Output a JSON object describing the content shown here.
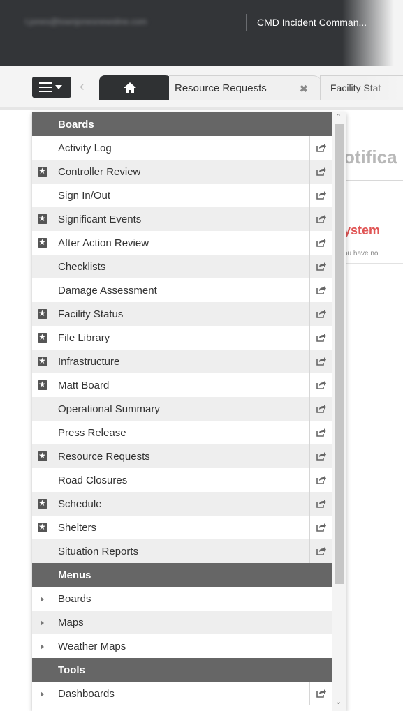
{
  "header": {
    "user_email": "t.jones@townjonesnewsline.com",
    "app_title": "CMD Incident Comman..."
  },
  "tabs": {
    "home_icon": "home-icon",
    "resource_requests": "Resource Requests",
    "facility_status": "Facility Stat"
  },
  "background": {
    "title": "otifica",
    "system": "ystem",
    "note": "ou have no"
  },
  "menu": {
    "boards_header": "Boards",
    "boards": [
      {
        "label": "Activity Log",
        "favorite": false
      },
      {
        "label": "Controller Review",
        "favorite": true
      },
      {
        "label": "Sign In/Out",
        "favorite": false
      },
      {
        "label": "Significant Events",
        "favorite": true
      },
      {
        "label": "After Action Review",
        "favorite": true
      },
      {
        "label": "Checklists",
        "favorite": false
      },
      {
        "label": "Damage Assessment",
        "favorite": false
      },
      {
        "label": "Facility Status",
        "favorite": true
      },
      {
        "label": "File Library",
        "favorite": true
      },
      {
        "label": "Infrastructure",
        "favorite": true
      },
      {
        "label": "Matt Board",
        "favorite": true
      },
      {
        "label": "Operational Summary",
        "favorite": false
      },
      {
        "label": "Press Release",
        "favorite": false
      },
      {
        "label": "Resource Requests",
        "favorite": true
      },
      {
        "label": "Road Closures",
        "favorite": false
      },
      {
        "label": "Schedule",
        "favorite": true
      },
      {
        "label": "Shelters",
        "favorite": true
      },
      {
        "label": "Situation Reports",
        "favorite": false
      }
    ],
    "menus_header": "Menus",
    "menus": [
      {
        "label": "Boards"
      },
      {
        "label": "Maps"
      },
      {
        "label": "Weather Maps"
      }
    ],
    "tools_header": "Tools",
    "tools": [
      {
        "label": "Dashboards"
      }
    ]
  }
}
